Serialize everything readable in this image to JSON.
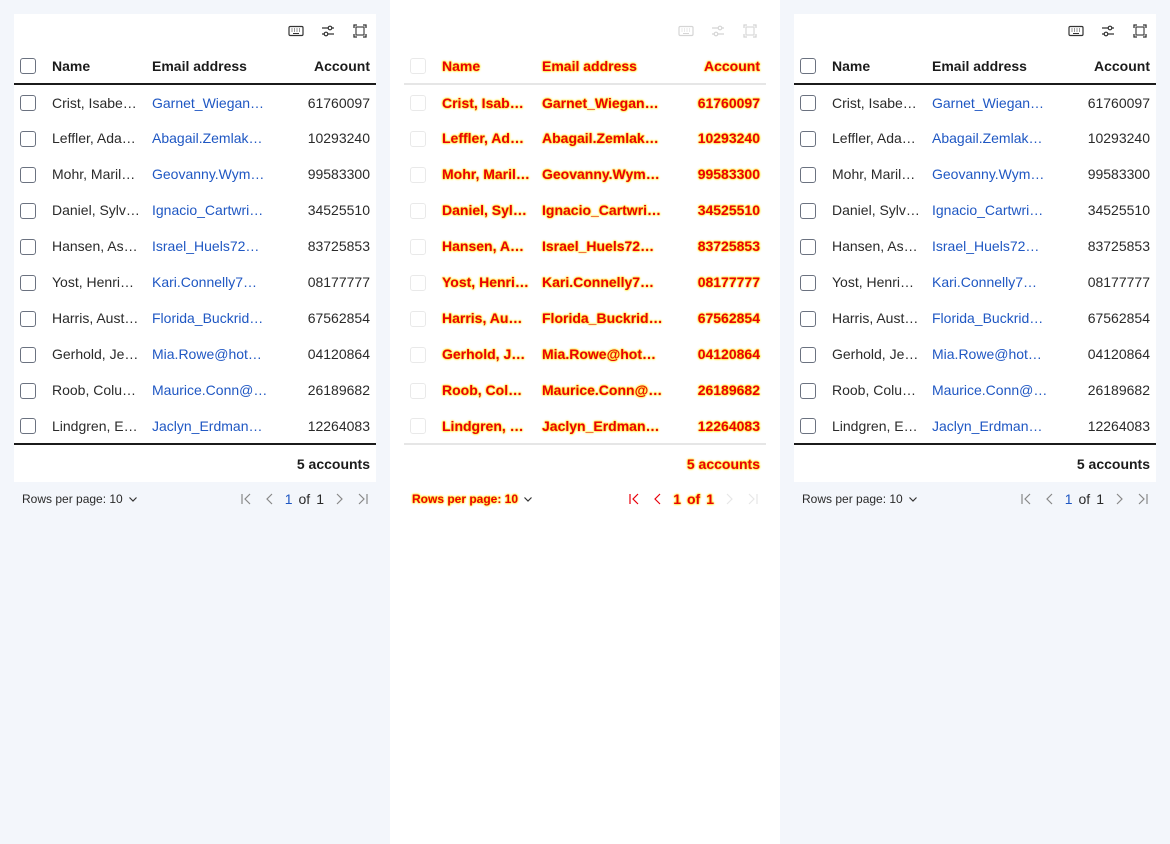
{
  "table": {
    "headers": {
      "name": "Name",
      "email": "Email address",
      "account": "Account"
    },
    "rows": [
      {
        "name": "Crist, Isabe…",
        "email": "Garnet_Wiegan…",
        "account": "61760097"
      },
      {
        "name": "Leffler, Ada…",
        "email": "Abagail.Zemlak…",
        "account": "10293240"
      },
      {
        "name": "Mohr, Maril…",
        "email": "Geovanny.Wym…",
        "account": "99583300"
      },
      {
        "name": "Daniel, Sylv…",
        "email": "Ignacio_Cartwri…",
        "account": "34525510"
      },
      {
        "name": "Hansen, As…",
        "email": "Israel_Huels72…",
        "account": "83725853"
      },
      {
        "name": "Yost, Henri…",
        "email": "Kari.Connelly7…",
        "account": "08177777"
      },
      {
        "name": "Harris, Aust…",
        "email": "Florida_Buckrid…",
        "account": "67562854"
      },
      {
        "name": "Gerhold, Je…",
        "email": "Mia.Rowe@hot…",
        "account": "04120864"
      },
      {
        "name": "Roob, Colu…",
        "email": "Maurice.Conn@…",
        "account": "26189682"
      },
      {
        "name": "Lindgren, E…",
        "email": "Jaclyn_Erdman…",
        "account": "12264083"
      }
    ],
    "footer": "5 accounts"
  },
  "pager": {
    "rows_per_page_label": "Rows per page: 10",
    "current_page": "1",
    "of_label": "of",
    "total_pages": "1"
  },
  "icons": {
    "toolbar": [
      "keyboard-icon",
      "filter-sliders-icon",
      "fullscreen-icon"
    ],
    "pager": [
      "first-page-icon",
      "prev-page-icon",
      "next-page-icon",
      "last-page-icon",
      "chevron-down-icon"
    ]
  },
  "colors": {
    "link": "#1f57c3",
    "highlight_text": "#e8000b",
    "highlight_glow": "#ffe600",
    "background": "#f3f6fb"
  }
}
